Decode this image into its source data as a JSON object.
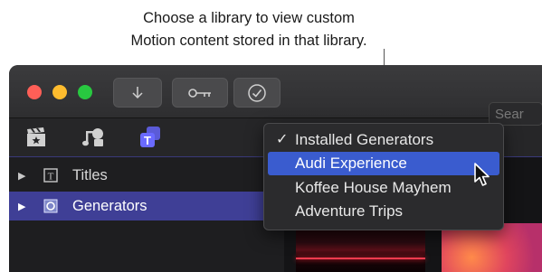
{
  "callout": {
    "line1": "Choose a library to view custom",
    "line2": "Motion content stored in that library."
  },
  "titlebar": {
    "buttons": [
      {
        "name": "import",
        "icon": "download-arrow-icon"
      },
      {
        "name": "keywords",
        "icon": "key-icon"
      },
      {
        "name": "analyze",
        "icon": "checkmark-circle-icon"
      }
    ]
  },
  "toolbar": {
    "icons": [
      "clapper-star-icon",
      "music-photo-icon",
      "titles-generators-icon"
    ]
  },
  "sidebar": {
    "items": [
      {
        "label": "Titles",
        "selected": false
      },
      {
        "label": "Generators",
        "selected": true
      }
    ]
  },
  "search": {
    "placeholder": "Sear"
  },
  "library_menu": {
    "items": [
      {
        "label": "Installed Generators",
        "checked": true
      },
      {
        "label": "Audi Experience",
        "highlighted": true
      },
      {
        "label": "Koffee House Mayhem"
      },
      {
        "label": "Adventure Trips"
      }
    ],
    "checkmark": "✓"
  },
  "colors": {
    "selection_blue": "#3f3f96",
    "menu_highlight": "#3a5ccf"
  }
}
